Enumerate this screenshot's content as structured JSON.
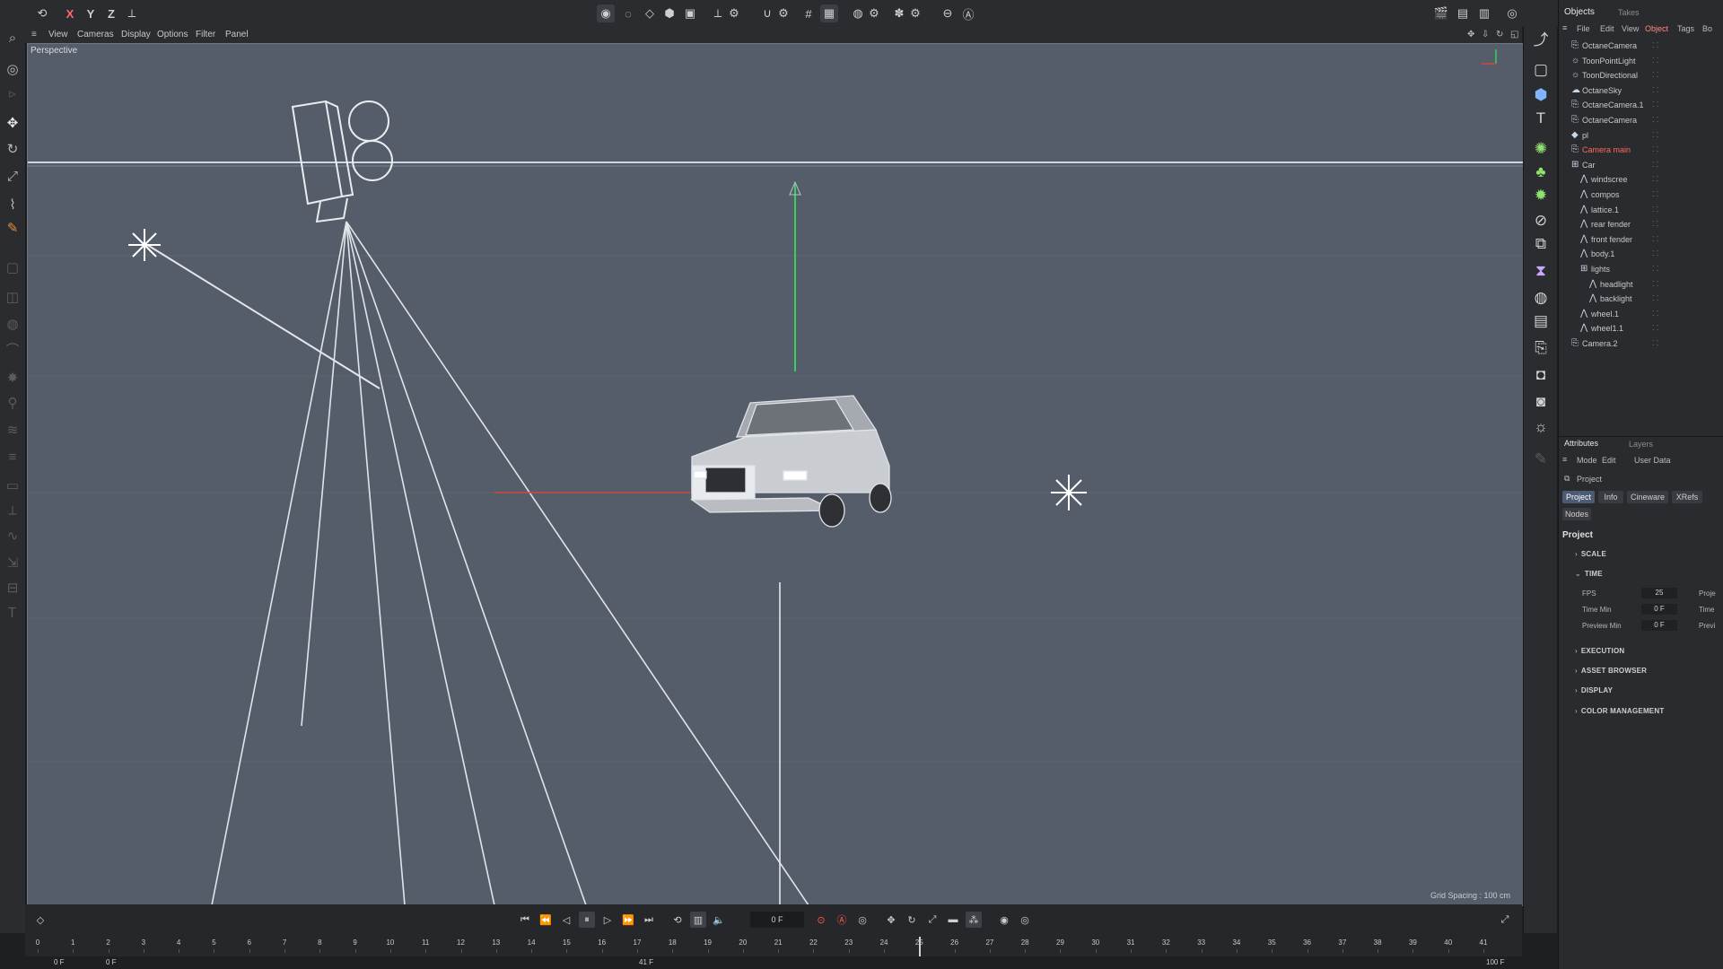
{
  "top_toolbar": {
    "axis_labels": [
      "X",
      "Y",
      "Z"
    ],
    "icons": [
      "undo-icon",
      "x-axis-lock-icon",
      "y-axis-lock-icon",
      "z-axis-lock-icon",
      "coordinate-system-icon",
      "model-mode-icon",
      "points-mode-icon",
      "edges-mode-icon",
      "polygons-mode-icon",
      "uv-mode-icon",
      "axis-icon",
      "axis-settings-icon",
      "snap-magnet-icon",
      "snap-settings-icon",
      "grid-snap-icon",
      "workplane-icon",
      "render-region-icon",
      "render-settings-icon",
      "octane-icon",
      "octane-settings-icon",
      "viewport-solo-icon",
      "lock-icon"
    ],
    "right_icons": [
      "clapper-icon",
      "render-view-icon",
      "picture-viewer-icon",
      "octane-live-icon"
    ]
  },
  "viewport_menu": [
    "View",
    "Cameras",
    "Display",
    "Options",
    "Filter",
    "Panel"
  ],
  "viewport": {
    "label": "Perspective",
    "grid_spacing": "Grid Spacing : 100 cm"
  },
  "left_tools": [
    "search-icon",
    "live-selection-icon",
    "select-icon",
    "move-icon",
    "rotate-icon",
    "scale-icon",
    "knife-icon",
    "paint-icon",
    "box-icon",
    "cube-icon",
    "sweep-icon",
    "bend-icon",
    "sculpt-icon",
    "rig-icon",
    "hair-icon",
    "layer-icon",
    "dim-icon",
    "measure-icon",
    "spline-icon",
    "shrink-icon",
    "align-icon",
    "text-icon"
  ],
  "right_tools": [
    "convert-icon",
    "cube-icon",
    "text-icon",
    "gear-settings-icon",
    "tree-icon",
    "bulb-icon",
    "deformer-icon",
    "scene-icon",
    "boolean-icon",
    "globe-icon",
    "clapper-icon",
    "camera-icon",
    "camera2-icon",
    "camera3-icon",
    "light-icon",
    "paint-brush-icon"
  ],
  "objects_panel": {
    "tabs": [
      "Objects",
      "Takes"
    ],
    "menu": [
      "File",
      "Edit",
      "View",
      "Object",
      "Tags",
      "Bo"
    ],
    "rows": [
      {
        "label": "OctaneCamera",
        "indent": 0,
        "icon": "camera-icon",
        "color": "#c9c9c9"
      },
      {
        "label": "ToonPointLight",
        "indent": 0,
        "icon": "light-icon",
        "color": "#c9c9c9"
      },
      {
        "label": "ToonDirectional",
        "indent": 0,
        "icon": "light-icon",
        "color": "#c9c9c9"
      },
      {
        "label": "OctaneSky",
        "indent": 0,
        "icon": "sky-icon",
        "color": "#c9c9c9"
      },
      {
        "label": "OctaneCamera.1",
        "indent": 0,
        "icon": "camera-icon",
        "color": "#c9c9c9"
      },
      {
        "label": "OctaneCamera",
        "indent": 0,
        "icon": "camera-icon",
        "color": "#c9c9c9"
      },
      {
        "label": "pl",
        "indent": 0,
        "icon": "plane-icon",
        "color": "#c9c9c9"
      },
      {
        "label": "Camera main",
        "indent": 0,
        "icon": "camera-icon",
        "color": "#ff6a5a"
      },
      {
        "label": "Car",
        "indent": 0,
        "icon": "null-icon",
        "color": "#c9c9c9"
      },
      {
        "label": "windscree",
        "indent": 1,
        "icon": "mesh-icon",
        "color": "#c9c9c9"
      },
      {
        "label": "compos",
        "indent": 1,
        "icon": "mesh-icon",
        "color": "#c9c9c9"
      },
      {
        "label": "lattice.1",
        "indent": 1,
        "icon": "mesh-icon",
        "color": "#c9c9c9"
      },
      {
        "label": "rear fender",
        "indent": 1,
        "icon": "mesh-icon",
        "color": "#c9c9c9"
      },
      {
        "label": "front fender",
        "indent": 1,
        "icon": "mesh-icon",
        "color": "#c9c9c9"
      },
      {
        "label": "body.1",
        "indent": 1,
        "icon": "mesh-icon",
        "color": "#c9c9c9"
      },
      {
        "label": "lights",
        "indent": 1,
        "icon": "null-icon",
        "color": "#c9c9c9"
      },
      {
        "label": "headlight",
        "indent": 2,
        "icon": "mesh-icon",
        "color": "#c9c9c9"
      },
      {
        "label": "backlight",
        "indent": 2,
        "icon": "mesh-icon",
        "color": "#c9c9c9"
      },
      {
        "label": "wheel.1",
        "indent": 1,
        "icon": "mesh-icon",
        "color": "#c9c9c9"
      },
      {
        "label": "wheel1.1",
        "indent": 1,
        "icon": "mesh-icon",
        "color": "#c9c9c9"
      },
      {
        "label": "Camera.2",
        "indent": 0,
        "icon": "camera-icon",
        "color": "#c9c9c9"
      }
    ]
  },
  "attributes_panel": {
    "tabs": [
      "Attributes",
      "Layers"
    ],
    "menu": [
      "Mode",
      "Edit",
      "User Data"
    ],
    "breadcrumb": "Project",
    "buttons": [
      "Project",
      "Info",
      "Cineware",
      "XRefs",
      "Nodes"
    ],
    "section_title": "Project",
    "sections": {
      "scale": "SCALE",
      "time": "TIME",
      "execution": "EXECUTION",
      "asset_browser": "ASSET BROWSER",
      "display": "DISPLAY",
      "color_management": "COLOR MANAGEMENT"
    },
    "time_fields": [
      {
        "label": "FPS",
        "value": "25",
        "right": "Proje"
      },
      {
        "label": "Time Min",
        "value": "0 F",
        "right": "Time"
      },
      {
        "label": "Preview Min",
        "value": "0 F",
        "right": "Previ"
      }
    ]
  },
  "timeline": {
    "current_frame": "0 F",
    "ticks": [
      "0",
      "1",
      "2",
      "3",
      "4",
      "5",
      "6",
      "7",
      "8",
      "9",
      "10",
      "11",
      "12",
      "13",
      "14",
      "15",
      "16",
      "17",
      "18",
      "19",
      "20",
      "21",
      "22",
      "23",
      "24",
      "25",
      "26",
      "27",
      "28",
      "29",
      "30",
      "31",
      "32",
      "33",
      "34",
      "35",
      "36",
      "37",
      "38",
      "39",
      "40",
      "41"
    ],
    "range_start": "0 F",
    "range_preview_start": "0 F",
    "range_preview_end": "41 F",
    "range_end": "100 F",
    "current_frame_value": 25
  }
}
